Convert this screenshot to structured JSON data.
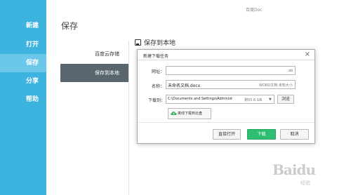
{
  "app": {
    "window_title": "百度Doc"
  },
  "sidebar": {
    "items": [
      {
        "label": "新建"
      },
      {
        "label": "打开"
      },
      {
        "label": "保存"
      },
      {
        "label": "分享"
      },
      {
        "label": "帮助"
      }
    ],
    "active": "保存"
  },
  "main": {
    "title": "保存",
    "sub_nav": [
      {
        "label": "百度云存储"
      },
      {
        "label": "保存到本地"
      }
    ],
    "section_title": "保存到本地"
  },
  "dialog": {
    "title": "新建下载任务",
    "close": "×",
    "url_label": "网址：",
    "url_value": "",
    "url_hint": "ab",
    "name_label": "名称：",
    "name_value": "未命名文档.docx",
    "name_meta": "WORD文档 未知大小",
    "download_to_label": "下载到：",
    "download_path": "C:\\Documents and Settings\\Administ",
    "download_space": "剩55.6 GB",
    "dropdown_arrow": "▼",
    "browse_label": "浏览",
    "cloud_button_label": "离线下载到云盘",
    "btn_open": "直接打开",
    "btn_download": "下载",
    "btn_cancel": "取消"
  },
  "watermark": {
    "text": "Baidu",
    "sub": "经验"
  },
  "colors": {
    "sidebar": "#3db3e0",
    "sidebar_active": "#6cc8ea",
    "subnav_active": "#5a666e",
    "primary": "#2fbd72"
  }
}
